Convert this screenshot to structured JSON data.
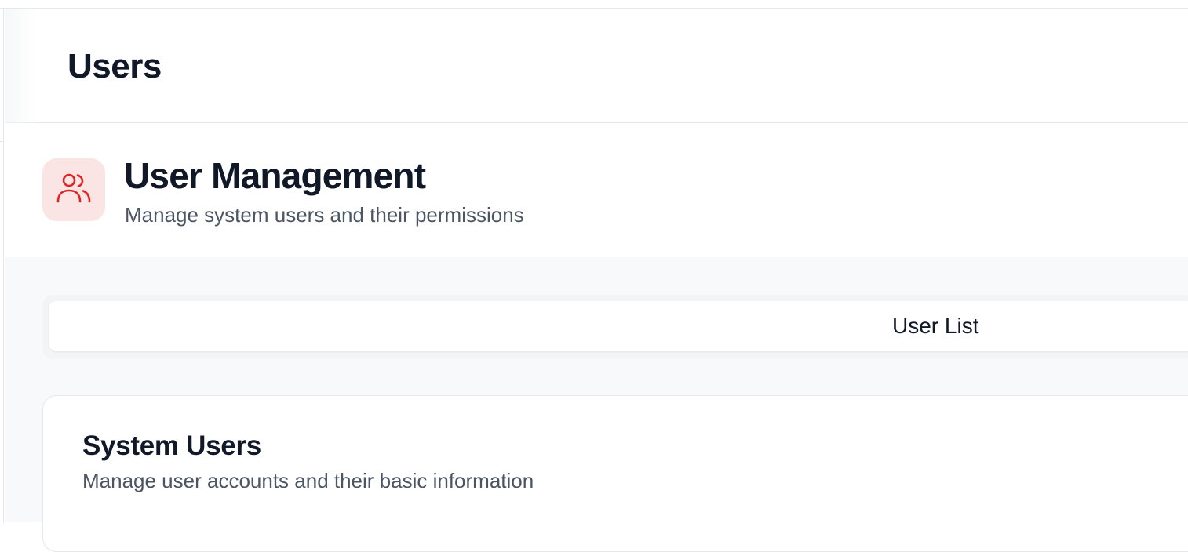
{
  "header": {
    "title": "Users"
  },
  "section": {
    "icon": "users-icon",
    "title": "User Management",
    "subtitle": "Manage system users and their permissions",
    "accent_color": "#dc2626",
    "icon_bg_color": "#fbe4e4"
  },
  "tabs": [
    {
      "label": "User List",
      "active": true
    }
  ],
  "card": {
    "title": "System Users",
    "subtitle": "Manage user accounts and their basic information"
  }
}
